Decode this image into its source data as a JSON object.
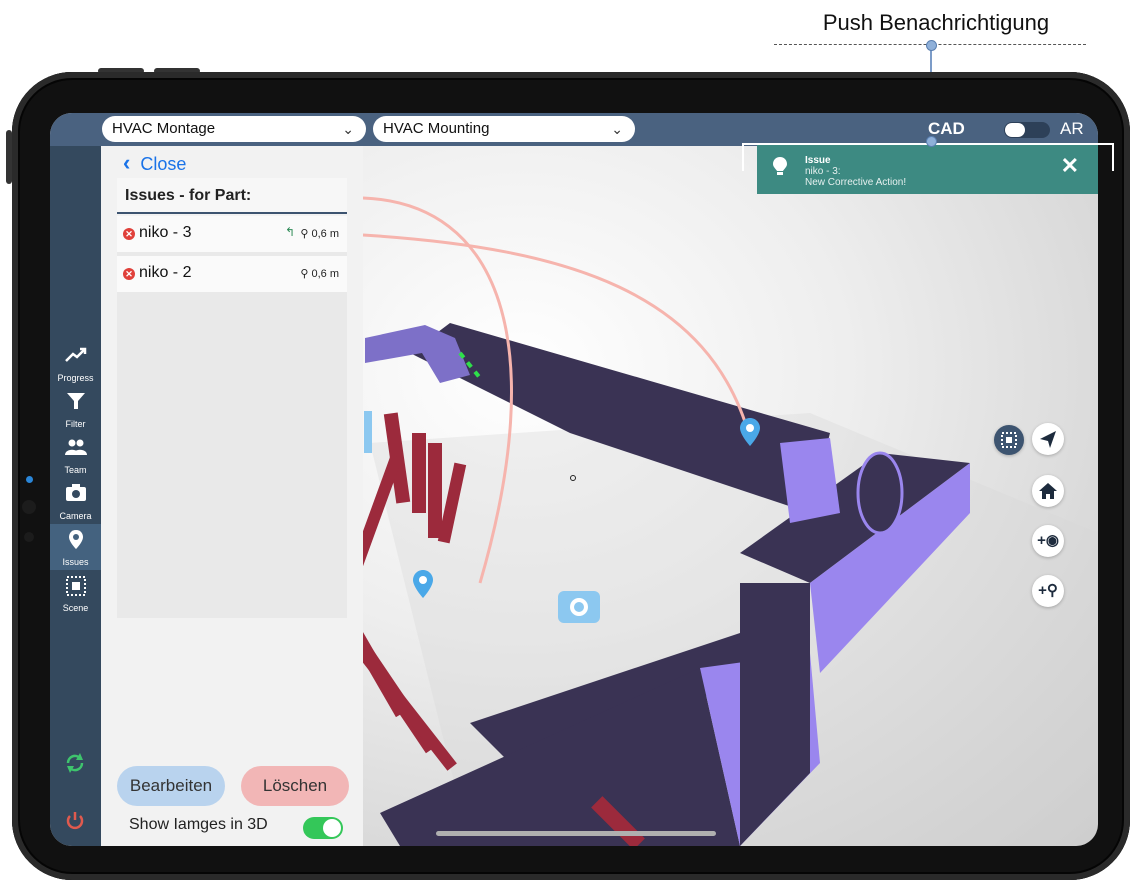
{
  "annotation": {
    "label": "Push Benachrichtigung"
  },
  "topbar": {
    "select1": "HVAC Montage",
    "select2": "HVAC Mounting",
    "cad_label": "CAD",
    "ar_label": "AR"
  },
  "nav": {
    "items": [
      {
        "label": "Progress",
        "icon": "trend-icon"
      },
      {
        "label": "Filter",
        "icon": "filter-icon"
      },
      {
        "label": "Team",
        "icon": "team-icon"
      },
      {
        "label": "Camera",
        "icon": "camera-icon"
      },
      {
        "label": "Issues",
        "icon": "pin-icon",
        "active": true
      },
      {
        "label": "Scene",
        "icon": "scene-icon"
      }
    ]
  },
  "panel": {
    "close_label": "Close",
    "heading": "Issues - for Part:",
    "issues": [
      {
        "name": "niko - 3",
        "distance": "0,6 m",
        "has_reply": true
      },
      {
        "name": "niko - 2",
        "distance": "0,6 m",
        "has_reply": false
      }
    ],
    "edit_label": "Bearbeiten",
    "delete_label": "Löschen",
    "show_images_label": "Show Iamges in 3D",
    "show_images_on": true
  },
  "notification": {
    "title": "Issue",
    "line1": "niko - 3:",
    "line2": "New Corrective Action!"
  },
  "colors": {
    "nav_bg": "#34495e",
    "topbar_bg": "#4a6280",
    "notif_bg": "#3d8a82",
    "duct": "#3a3354",
    "duct_side": "#9a86ee",
    "pipes": "#9c2a3c",
    "marker": "#4aa8e8"
  }
}
